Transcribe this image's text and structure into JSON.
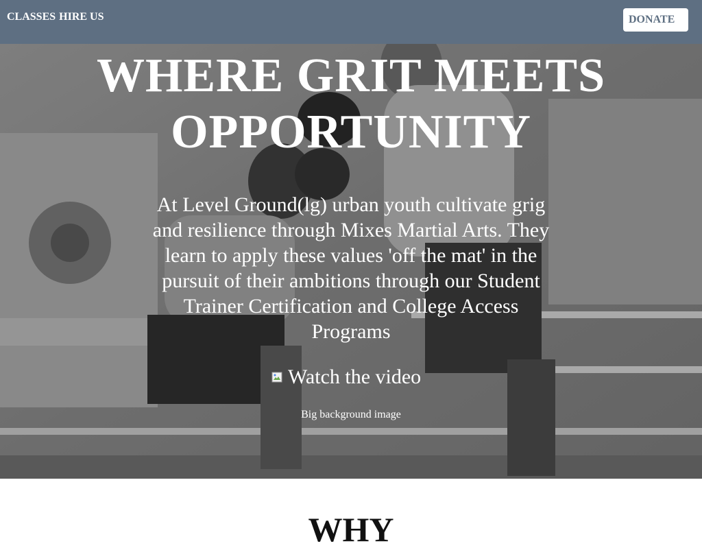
{
  "nav": {
    "items": [
      {
        "label": "CLASSES"
      },
      {
        "label": "HIRE US"
      }
    ],
    "donate_label": "DONATE"
  },
  "hero": {
    "headline_line1": "WHERE GRIT MEETS",
    "headline_line2": "OPPORTUNITY",
    "blurb": "At Level Ground(lg) urban youth cultivate grig and resilience through Mixes Martial Arts. They learn to apply these values 'off the mat' in the pursuit of their ambitions through our Student Trainer Certification and College Access Programs",
    "video_link_label": "Watch the video",
    "background_caption": "Big background image"
  },
  "section": {
    "why_heading": "WHY"
  },
  "colors": {
    "header_bg": "#5e6f82",
    "donate_text": "#5e6f82",
    "hero_text": "#ffffff"
  },
  "icons": {
    "video": "broken-image-icon"
  }
}
